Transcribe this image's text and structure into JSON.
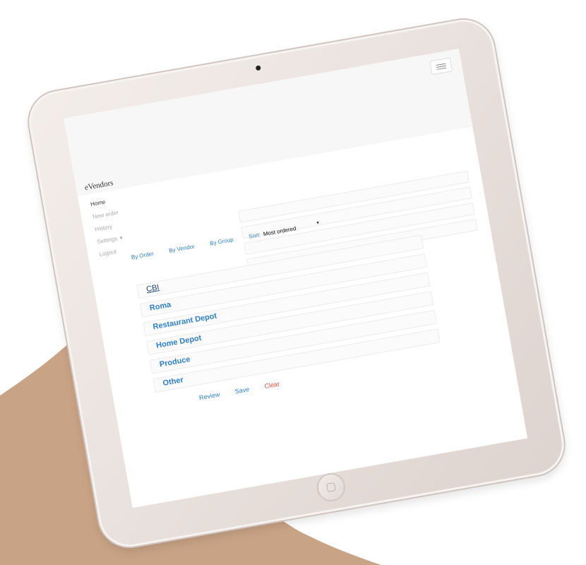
{
  "app": {
    "brand": "eVendors",
    "menu": {
      "home": "Home",
      "new_order": "New order",
      "history": "History",
      "settings": "Settings",
      "logout": "Logout"
    }
  },
  "toolbar": {
    "by_order": "By Order",
    "by_vendor": "By Vendor",
    "by_group": "By Group",
    "sort_label": "Sort:",
    "sort_value": "Most ordered"
  },
  "vendors": [
    "CBI",
    "Roma",
    "Restaurant Depot",
    "Home Depot",
    "Produce",
    "Other"
  ],
  "actions": {
    "review": "Review",
    "save": "Save",
    "clear": "Clear"
  },
  "colors": {
    "link": "#2f7fc8",
    "danger": "#e34b3f",
    "navbar": "#f7f7f7",
    "tablet_frame": "#ebe3df"
  }
}
